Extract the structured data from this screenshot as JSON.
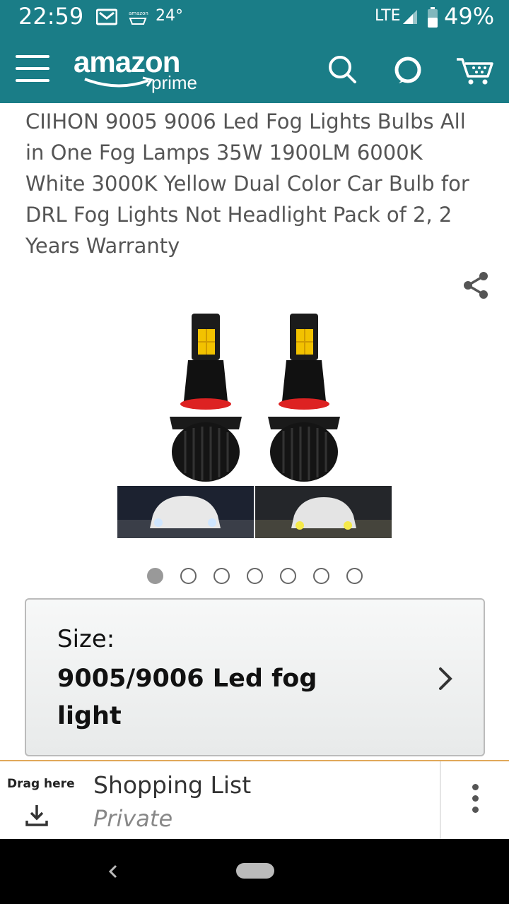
{
  "status_bar": {
    "time": "22:59",
    "notification_amazon": "amazon",
    "temperature": "24°",
    "network": "LTE",
    "battery": "49%",
    "icons": [
      "gmail-icon",
      "amazon-notification-icon",
      "signal-icon",
      "battery-icon"
    ]
  },
  "header": {
    "logo_word": "amazon",
    "logo_sub": "prime",
    "icons": [
      "menu-icon",
      "search-icon",
      "alexa-icon",
      "cart-icon"
    ],
    "brand_color": "#1a7d87"
  },
  "product": {
    "title": "CIIHON 9005 9006 Led Fog Lights Bulbs All in One Fog Lamps 35W 1900LM 6000K White 3000K Yellow Dual Color Car Bulb for DRL Fog Lights Not Headlight Pack of 2, 2 Years Warranty",
    "image_count": 7,
    "active_image_index": 1
  },
  "size": {
    "label": "Size:",
    "value": "9005/9006 Led fog light"
  },
  "shopping_list": {
    "drag_label": "Drag here",
    "name": "Shopping List",
    "privacy": "Private",
    "accent_color": "#e0a85a"
  },
  "navigation": {
    "icons": [
      "back-icon",
      "home-pill-icon"
    ]
  }
}
